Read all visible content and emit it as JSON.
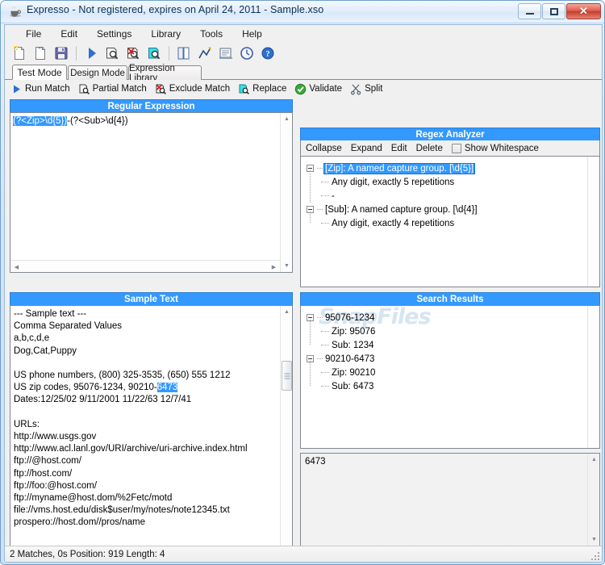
{
  "window": {
    "title": "Expresso - Not registered, expires on April 24, 2011 - Sample.xso",
    "icon": "coffee-cup-icon",
    "minimize_label": "–",
    "maximize_label": "□",
    "close_label": "✕",
    "accent_blue": "#3399ff",
    "selection_blue": "#3399ff"
  },
  "menubar": {
    "items": [
      {
        "label": "File"
      },
      {
        "label": "Edit"
      },
      {
        "label": "Settings"
      },
      {
        "label": "Library"
      },
      {
        "label": "Tools"
      },
      {
        "label": "Help"
      }
    ]
  },
  "toolbar": {
    "buttons": [
      {
        "name": "new-document-icon"
      },
      {
        "name": "open-document-icon"
      },
      {
        "name": "save-icon"
      },
      {
        "name": "run-match-icon"
      },
      {
        "name": "partial-match-icon"
      },
      {
        "name": "exclude-match-icon"
      },
      {
        "name": "replace-icon"
      },
      {
        "name": "library-book-icon"
      },
      {
        "name": "analyze-chart-icon"
      },
      {
        "name": "report-icon"
      },
      {
        "name": "history-clock-icon"
      },
      {
        "name": "help-icon"
      }
    ]
  },
  "tabs": [
    {
      "label": "Test Mode",
      "active": true
    },
    {
      "label": "Design Mode",
      "active": false
    },
    {
      "label": "Expression Library",
      "active": false
    }
  ],
  "actions": [
    {
      "label": "Run Match",
      "icon": "play-triangle-icon"
    },
    {
      "label": "Partial Match",
      "icon": "partial-match-icon"
    },
    {
      "label": "Exclude Match",
      "icon": "exclude-match-icon"
    },
    {
      "label": "Replace",
      "icon": "replace-icon"
    },
    {
      "label": "Validate",
      "icon": "green-check-icon"
    },
    {
      "label": "Split",
      "icon": "scissors-icon"
    }
  ],
  "regex_panel": {
    "title": "Regular Expression",
    "selected_text": "(?<Zip>\\d{5})",
    "rest_text": "-(?<Sub>\\d{4})"
  },
  "analyzer_panel": {
    "title": "Regex Analyzer",
    "tools": [
      {
        "label": "Collapse"
      },
      {
        "label": "Expand"
      },
      {
        "label": "Edit"
      },
      {
        "label": "Delete"
      }
    ],
    "checkbox_label": "Show Whitespace",
    "checkbox_checked": false,
    "tree": [
      {
        "label": "[Zip]: A named capture group. [\\d{5}]",
        "selected": true,
        "children": [
          {
            "label": "Any digit, exactly 5 repetitions"
          }
        ]
      },
      {
        "label": "-",
        "leaf_dash": true,
        "children": []
      },
      {
        "label": "[Sub]: A named capture group. [\\d{4}]",
        "selected": false,
        "children": [
          {
            "label": "Any digit, exactly 4 repetitions"
          }
        ]
      }
    ]
  },
  "sample_panel": {
    "title": "Sample Text",
    "lines_before": "--- Sample text ---\nComma Separated Values\na,b,c,d,e\nDog,Cat,Puppy\n\nUS phone numbers, (800) 325-3535, (650) 555 1212\nUS zip codes, 95076-1234, 90210-",
    "highlighted": "6473",
    "lines_after": "\nDates:12/25/02 9/11/2001 11/22/63 12/7/41\n\nURLs:\nhttp://www.usgs.gov\nhttp://www.acl.lanl.gov/URI/archive/uri-archive.index.html\nftp://@host.com/\nftp://host.com/\nftp://foo:@host.com/\nftp://myname@host.dom/%2Fetc/motd\nfile://vms.host.edu/disk$user/my/notes/note12345.txt\nprospero://host.dom//pros/name"
  },
  "results_panel": {
    "title": "Search Results",
    "watermark": "SnapFiles",
    "matches": [
      {
        "label": "95076-1234",
        "children": [
          {
            "label": "Zip: 95076"
          },
          {
            "label": "Sub: 1234"
          }
        ]
      },
      {
        "label": "90210-6473",
        "children": [
          {
            "label": "Zip: 90210"
          },
          {
            "label": "Sub: 6473"
          }
        ]
      }
    ]
  },
  "detail_panel": {
    "value": "6473"
  },
  "statusbar": {
    "text": "2 Matches, 0s  Position: 919  Length: 4"
  }
}
